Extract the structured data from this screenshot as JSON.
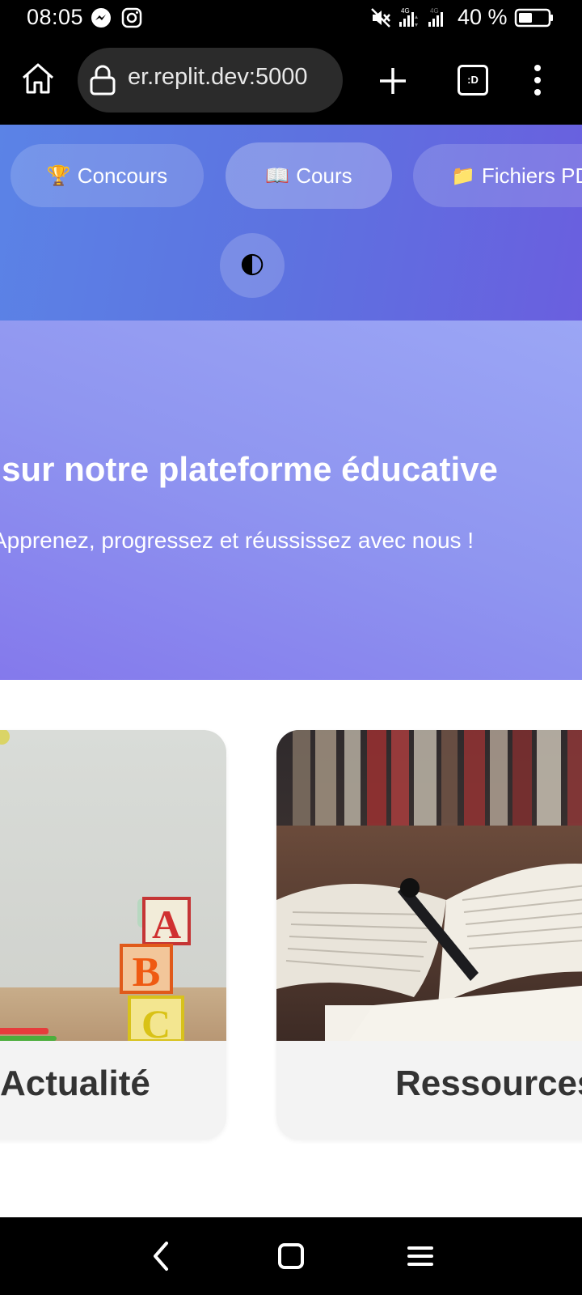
{
  "status_bar": {
    "time": "08:05",
    "battery": "40 %",
    "icons": [
      "messenger-icon",
      "instagram-icon",
      "mute-icon",
      "signal-4g-icon",
      "signal-4g-icon",
      "battery-icon"
    ]
  },
  "browser": {
    "url": "er.replit.dev:5000",
    "tabs_label": ":D",
    "icons": [
      "home-icon",
      "lock-icon",
      "plus-icon",
      "tabs-icon",
      "more-vert-icon"
    ]
  },
  "nav": {
    "items": [
      {
        "emoji": "🏆",
        "label": "Concours"
      },
      {
        "emoji": "📖",
        "label": "Cours"
      },
      {
        "emoji": "📁",
        "label": "Fichiers PDF"
      }
    ],
    "theme_toggle_emoji": "🌓"
  },
  "hero": {
    "title": "Bienvenue sur notre plateforme éducative",
    "subtitle": "Apprenez, progressez et réussissez avec nous !"
  },
  "cards": [
    {
      "title": "Actualité",
      "image": "abc-blocks"
    },
    {
      "title": "Ressources",
      "image": "open-book-with-pen"
    }
  ],
  "colors": {
    "header_start": "#5b83e6",
    "header_end": "#6a5fdf",
    "hero_start": "#9ba6f5",
    "hero_end": "#8479ec",
    "card_bg": "#f3f3f3"
  },
  "system_nav": {
    "icons": [
      "back-icon",
      "home-square-icon",
      "recents-icon"
    ]
  }
}
